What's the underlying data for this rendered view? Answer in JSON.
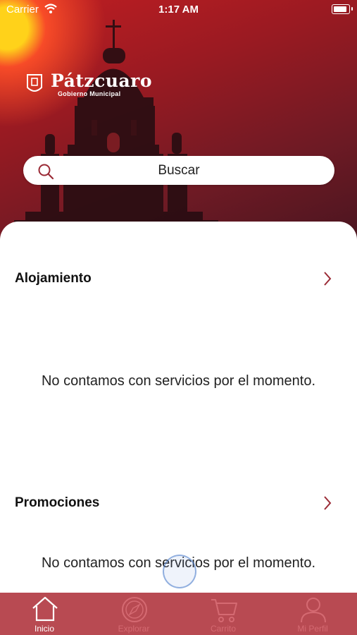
{
  "status_bar": {
    "carrier": "Carrier",
    "time": "1:17 AM"
  },
  "header": {
    "logo_name": "Pátzcuaro",
    "logo_subtitle": "Gobierno Municipal",
    "search_label": "Buscar"
  },
  "sections": [
    {
      "title": "Alojamiento",
      "empty_message": "No contamos con servicios por el momento."
    },
    {
      "title": "Promociones",
      "empty_message": "No contamos con servicios por el momento."
    }
  ],
  "tabbar": {
    "items": [
      {
        "label": "Inicio",
        "icon": "home-icon",
        "active": true
      },
      {
        "label": "Explorar",
        "icon": "compass-icon",
        "active": false
      },
      {
        "label": "Carrito",
        "icon": "cart-icon",
        "active": false
      },
      {
        "label": "Mi Perfil",
        "icon": "user-icon",
        "active": false
      }
    ]
  },
  "colors": {
    "accent": "#b84a52",
    "hero_dark": "#4a1520",
    "chevron": "#9a2a35"
  }
}
